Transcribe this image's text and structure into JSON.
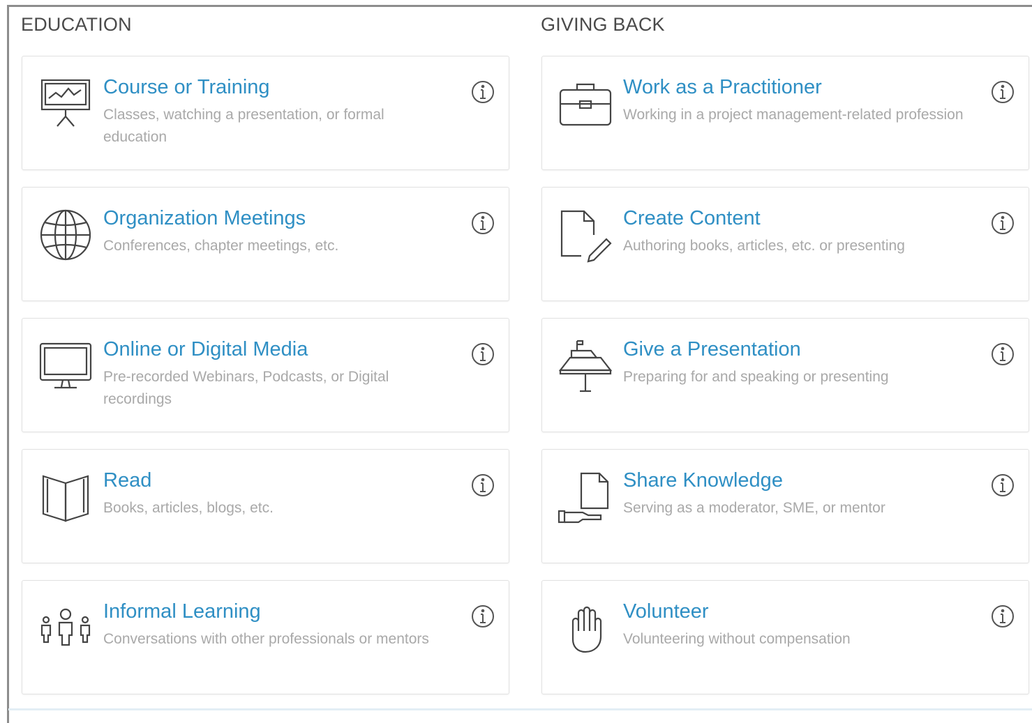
{
  "columns": [
    {
      "heading": "EDUCATION",
      "items": [
        {
          "icon": "presentation-board-icon",
          "title": "Course or Training",
          "description": "Classes, watching a presentation, or formal education"
        },
        {
          "icon": "globe-icon",
          "title": "Organization Meetings",
          "description": "Conferences, chapter meetings, etc."
        },
        {
          "icon": "monitor-icon",
          "title": "Online or Digital Media",
          "description": "Pre-recorded Webinars, Podcasts, or Digital recordings"
        },
        {
          "icon": "open-book-icon",
          "title": "Read",
          "description": "Books, articles, blogs, etc."
        },
        {
          "icon": "people-group-icon",
          "title": "Informal Learning",
          "description": "Conversations with other professionals or mentors"
        }
      ]
    },
    {
      "heading": "GIVING BACK",
      "items": [
        {
          "icon": "briefcase-icon",
          "title": "Work as a Practitioner",
          "description": "Working in a project management-related profession"
        },
        {
          "icon": "document-pencil-icon",
          "title": "Create Content",
          "description": "Authoring books, articles, etc. or presenting"
        },
        {
          "icon": "podium-icon",
          "title": "Give a Presentation",
          "description": "Preparing for and speaking or presenting"
        },
        {
          "icon": "hand-document-icon",
          "title": "Share Knowledge",
          "description": "Serving as a moderator, SME, or mentor"
        },
        {
          "icon": "raised-hand-icon",
          "title": "Volunteer",
          "description": "Volunteering without compensation"
        }
      ]
    }
  ],
  "info_icon": "info-circle-icon"
}
